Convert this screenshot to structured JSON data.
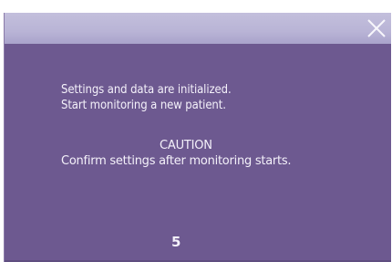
{
  "dialog": {
    "message_lines": [
      "Settings and data are initialized.",
      "Start monitoring a new patient."
    ],
    "caution_title": "CAUTION",
    "caution_text": "Confirm settings after monitoring starts.",
    "countdown": "5",
    "close_icon": "close-icon"
  },
  "colors": {
    "dialog_background": "#6d5990",
    "title_bar": "#b9b4d6",
    "text": "#f4f1fa"
  }
}
